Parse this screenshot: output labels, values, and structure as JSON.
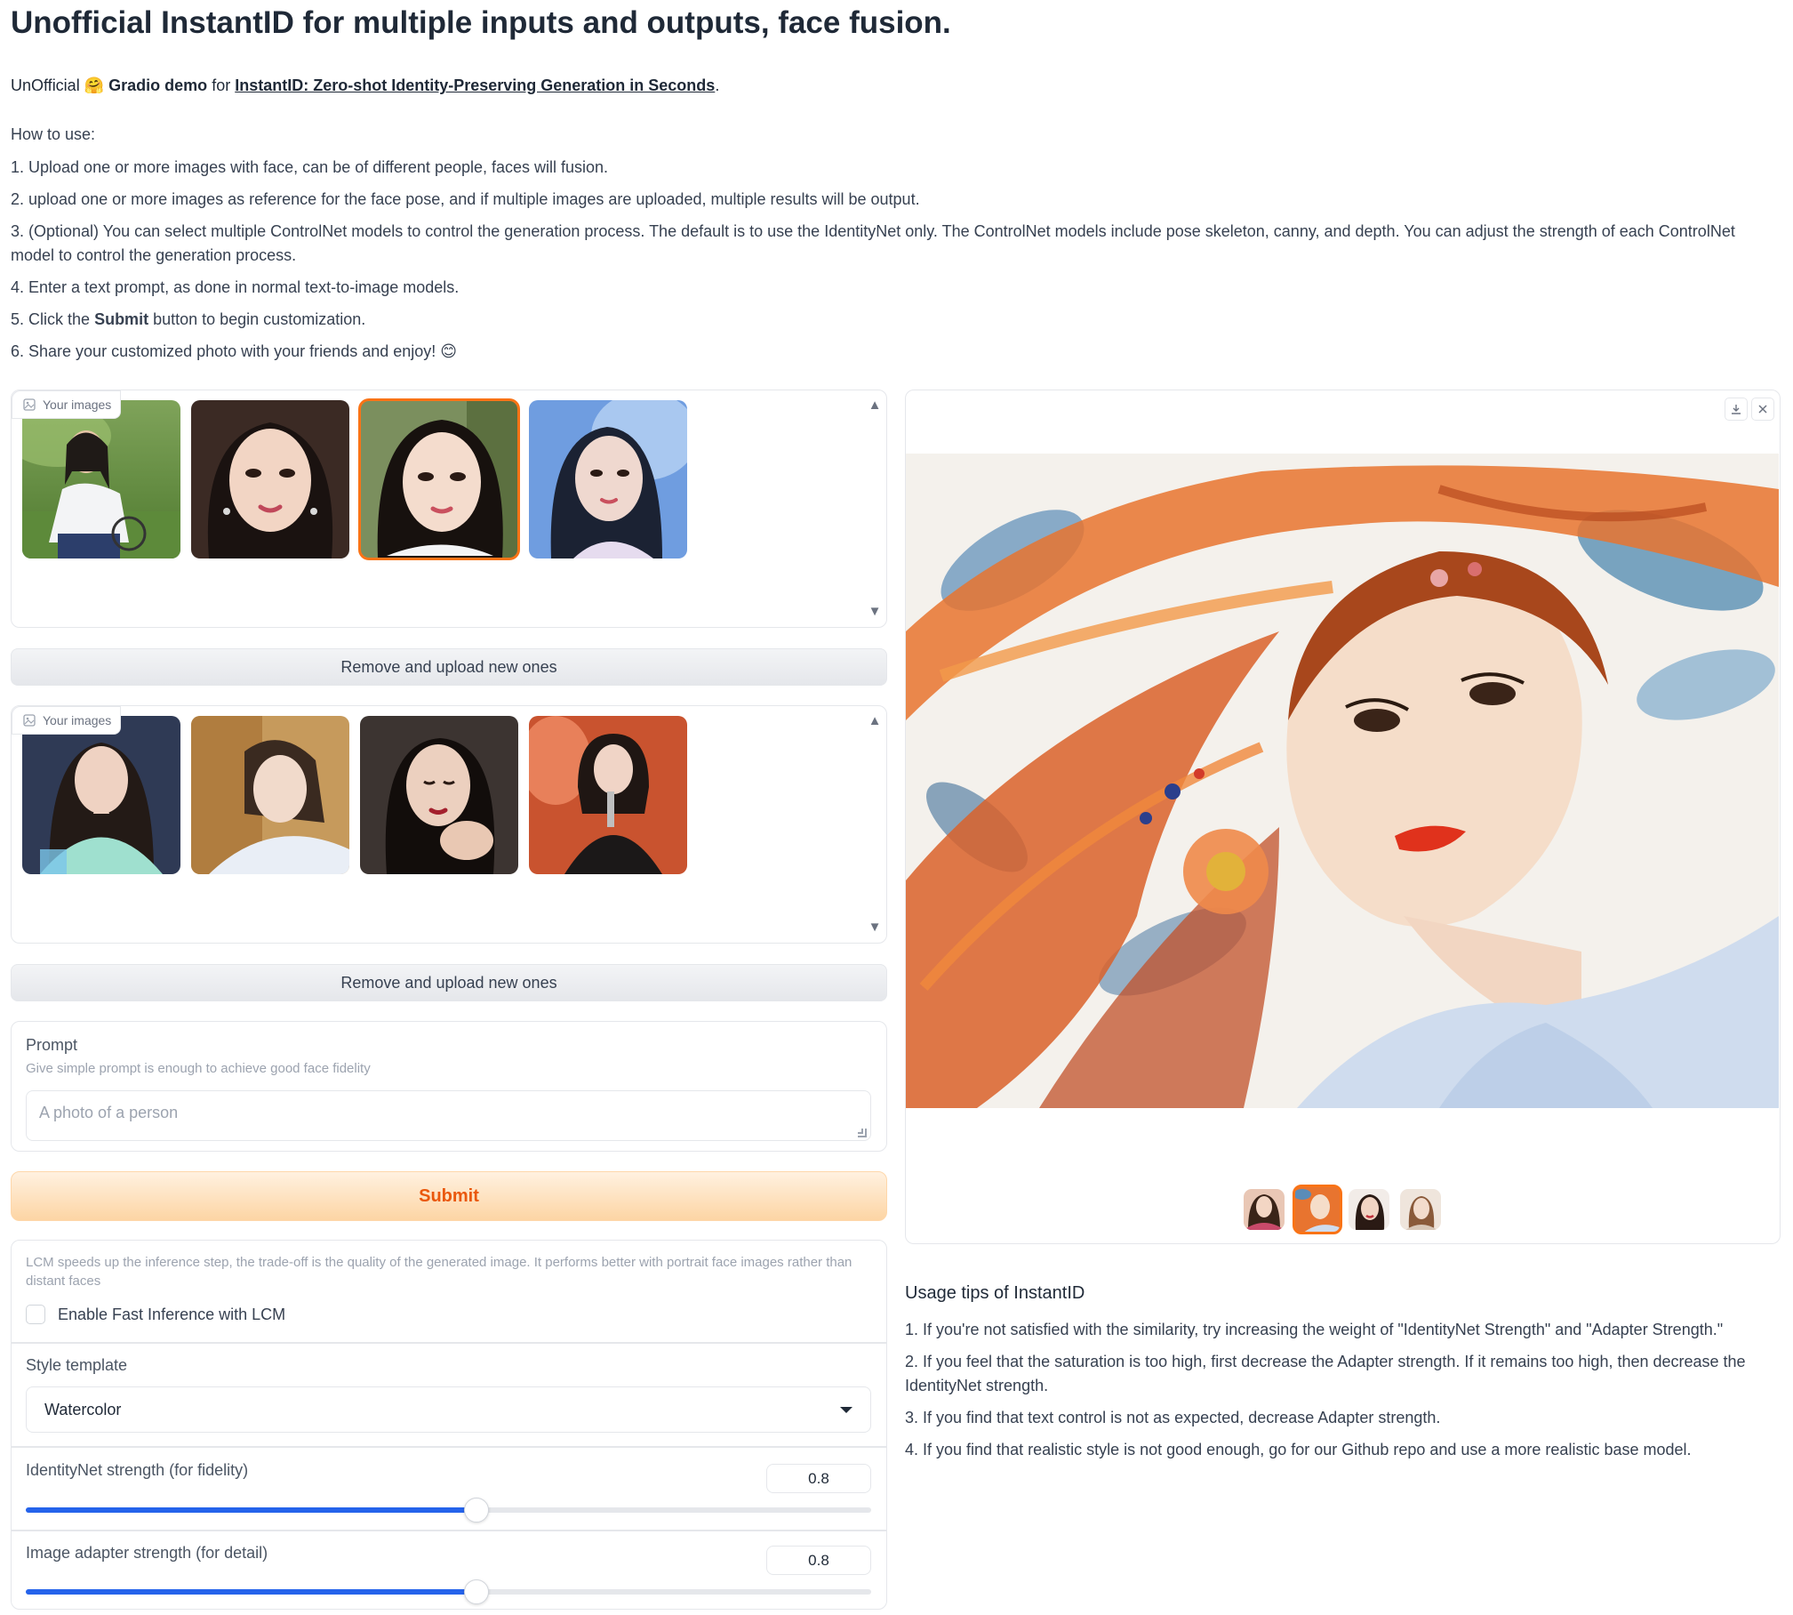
{
  "header": {
    "title": "Unofficial InstantID for multiple inputs and outputs, face fusion.",
    "intro_prefix": "UnOfficial",
    "intro_emoji": "🤗",
    "intro_bold": "Gradio demo",
    "intro_for": "for",
    "intro_link": "InstantID: Zero-shot Identity-Preserving Generation in Seconds",
    "intro_end": "."
  },
  "howto": {
    "heading": "How to use:",
    "step1": "1. Upload one or more images with face, can be of different people, faces will fusion.",
    "step2": "2. upload one or more images as reference for the face pose, and if multiple images are uploaded, multiple results will be output.",
    "step3": "3. (Optional) You can select multiple ControlNet models to control the generation process. The default is to use the IdentityNet only. The ControlNet models include pose skeleton, canny, and depth. You can adjust the strength of each ControlNet model to control the generation process.",
    "step4": "4. Enter a text prompt, as done in normal text-to-image models.",
    "step5_pre": "5. Click the",
    "step5_bold": "Submit",
    "step5_post": "button to begin customization.",
    "step6": "6. Share your customized photo with your friends and enjoy!",
    "step6_emoji": "😊"
  },
  "face_gallery": {
    "label": "Your images",
    "thumbs": [
      "girl-in-park",
      "portrait-earrings",
      "portrait-hair-ornament",
      "portrait-blue-background"
    ]
  },
  "remove_button_1": "Remove and upload new ones",
  "pose_gallery": {
    "label": "Your images",
    "thumbs": [
      "praying-pose",
      "lying-pose",
      "hand-on-face-pose",
      "singing-pose"
    ]
  },
  "remove_button_2": "Remove and upload new ones",
  "prompt": {
    "label": "Prompt",
    "info": "Give simple prompt is enough to achieve good face fidelity",
    "placeholder": "A photo of a person"
  },
  "submit_label": "Submit",
  "settings": {
    "lcm_info": "LCM speeds up the inference step, the trade-off is the quality of the generated image. It performs better with portrait face images rather than distant faces",
    "lcm_label": "Enable Fast Inference with LCM",
    "lcm_checked": false,
    "style_label": "Style template",
    "style_value": "Watercolor",
    "identitynet_label": "IdentityNet strength (for fidelity)",
    "identitynet_value": "0.8",
    "identitynet_fraction": 0.533,
    "adapter_label": "Image adapter strength (for detail)",
    "adapter_value": "0.8",
    "adapter_fraction": 0.533
  },
  "output": {
    "download_icon": "download-icon",
    "close_icon": "close-icon",
    "main_image": "watercolor-portrait",
    "selected_index": 1,
    "thumbs": [
      "result-1",
      "result-2",
      "result-3",
      "result-4"
    ]
  },
  "tips": {
    "title": "Usage tips of InstantID",
    "tip1": "1. If you're not satisfied with the similarity, try increasing the weight of \"IdentityNet Strength\" and \"Adapter Strength.\"",
    "tip2": "2. If you feel that the saturation is too high, first decrease the Adapter strength. If it remains too high, then decrease the IdentityNet strength.",
    "tip3": "3. If you find that text control is not as expected, decrease Adapter strength.",
    "tip4": "4. If you find that realistic style is not good enough, go for our Github repo and use a more realistic base model."
  },
  "colors": {
    "accent": "#f97316",
    "slider": "#2563eb",
    "submit_text": "#ea580c"
  }
}
